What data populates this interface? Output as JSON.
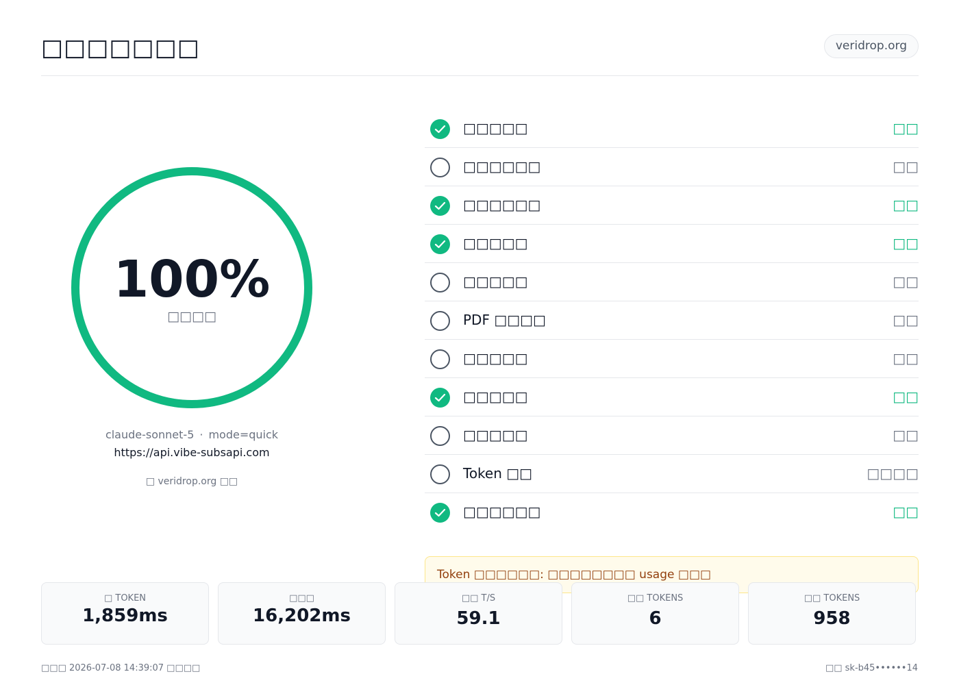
{
  "header": {
    "title": "□□□□□□□",
    "site_badge": "veridrop.org"
  },
  "gauge": {
    "percent_text": "100%",
    "percent_value": 100,
    "label": "□□□□",
    "color": "#10b981"
  },
  "model_info": {
    "model": "claude-sonnet-5",
    "separator": "·",
    "mode": "mode=quick",
    "url": "https://api.vibe-subsapi.com",
    "powered_by": "□ veridrop.org □□"
  },
  "checks": [
    {
      "label": "□□□□□",
      "status": "□□",
      "state": "pass"
    },
    {
      "label": "□□□□□□",
      "status": "□□",
      "state": "pending"
    },
    {
      "label": "□□□□□□",
      "status": "□□",
      "state": "pass"
    },
    {
      "label": "□□□□□",
      "status": "□□",
      "state": "pass"
    },
    {
      "label": "□□□□□",
      "status": "□□",
      "state": "pending"
    },
    {
      "label": "PDF □□□□",
      "status": "□□",
      "state": "pending"
    },
    {
      "label": "□□□□□",
      "status": "□□",
      "state": "pending"
    },
    {
      "label": "□□□□□",
      "status": "□□",
      "state": "pass"
    },
    {
      "label": "□□□□□",
      "status": "□□",
      "state": "pending"
    },
    {
      "label": "Token □□",
      "status": "□□□□",
      "state": "pending"
    },
    {
      "label": "□□□□□□",
      "status": "□□",
      "state": "pass"
    }
  ],
  "warning": {
    "text": "Token □□□□□□: □□□□□□□□ usage □□□"
  },
  "stats": [
    {
      "label": "□ TOKEN",
      "value": "1,859ms"
    },
    {
      "label": "□□□",
      "value": "16,202ms"
    },
    {
      "label": "□□ T/S",
      "value": "59.1"
    },
    {
      "label": "□□ TOKENS",
      "value": "6"
    },
    {
      "label": "□□ TOKENS",
      "value": "958"
    }
  ],
  "footer": {
    "left": "□□□ 2026-07-08 14:39:07 □□□□",
    "right": "□□ sk-b45••••••14"
  }
}
